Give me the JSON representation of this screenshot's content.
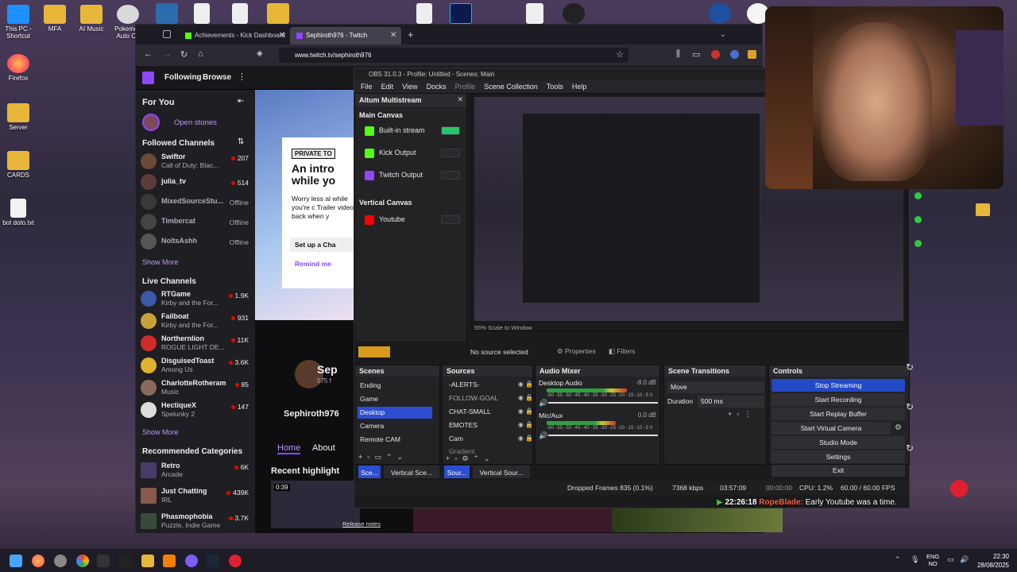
{
  "desktop": {
    "icons": [
      "This PC - Shortcut",
      "Firefox",
      "Server",
      "CARDS",
      "bot doto.txt"
    ],
    "top_icons": [
      "MFA",
      "AI Music",
      "Pokemon Auto Ch"
    ]
  },
  "browser": {
    "tabs": [
      {
        "label": "Achievements - Kick Dashboard"
      },
      {
        "label": "Sephiroth976 - Twitch"
      }
    ],
    "url": "www.twitch.tv/sephiroth976"
  },
  "twitch": {
    "nav": {
      "following": "Following",
      "browse": "Browse"
    },
    "for_you": "For You",
    "open_stories": "Open stories",
    "followed_header": "Followed Channels",
    "followed": [
      {
        "name": "Swiftor",
        "sub": "Call of Duty: Blac...",
        "viewers": "207"
      },
      {
        "name": "julia_tv",
        "sub": "",
        "viewers": "514"
      },
      {
        "name": "MixedSourceStu...",
        "sub": "",
        "viewers": "Offline"
      },
      {
        "name": "Timbercat",
        "sub": "",
        "viewers": "Offline"
      },
      {
        "name": "NoltsAshh",
        "sub": "",
        "viewers": "Offline"
      }
    ],
    "show_more": "Show More",
    "live_header": "Live Channels",
    "live": [
      {
        "name": "RTGame",
        "sub": "Kirby and the For...",
        "viewers": "1.9K"
      },
      {
        "name": "Failboat",
        "sub": "Kirby and the For...",
        "viewers": "931"
      },
      {
        "name": "Northernlion",
        "sub": "ROGUE LIGHT DE...",
        "viewers": "11K"
      },
      {
        "name": "DisguisedToast",
        "sub": "Among Us",
        "viewers": "3.6K"
      },
      {
        "name": "CharlotteRotheram",
        "sub": "Music",
        "viewers": "85"
      },
      {
        "name": "HectiqueX",
        "sub": "Spelunky 2",
        "viewers": "147"
      }
    ],
    "rec_header": "Recommended Categories",
    "categories": [
      {
        "name": "Retro",
        "sub": "Arcade",
        "viewers": "6K"
      },
      {
        "name": "Just Chatting",
        "sub": "IRL",
        "viewers": "439K"
      },
      {
        "name": "Phasmophobia",
        "sub": "Puzzle, Indie Game",
        "viewers": "3.7K"
      }
    ],
    "promo": {
      "badge": "PRIVATE TO",
      "headline": "An intro while yo",
      "body": "Worry less al while you're c Trailer video back when y",
      "cta1": "Set up a Cha",
      "cta2": "Remind me"
    },
    "channel": {
      "name": "Sephiroth976",
      "short": "Sep",
      "followers": "575 f",
      "tab_home": "Home",
      "tab_about": "About",
      "recent": "Recent highlight",
      "duration": "0:39",
      "release_notes": "Release notes"
    }
  },
  "obs": {
    "title": "OBS 31.0.3 - Profile: Untitled - Scenes: Main",
    "menu": [
      "File",
      "Edit",
      "View",
      "Docks",
      "Profile",
      "Scene Collection",
      "Tools",
      "Help"
    ],
    "multistream": {
      "title": "Aitum Multistream",
      "main_canvas": "Main Canvas",
      "outputs": [
        {
          "label": "Built-in stream",
          "on": true,
          "color": "#29c46a"
        },
        {
          "label": "Kick Output",
          "on": false,
          "color": "#53fc18"
        },
        {
          "label": "Twitch Output",
          "on": false,
          "color": "#9146ff"
        }
      ],
      "vertical_canvas": "Vertical Canvas",
      "vertical_outputs": [
        {
          "label": "Youtube",
          "on": false,
          "color": "#ff0000"
        }
      ]
    },
    "no_source": "No source selected",
    "properties": "Properties",
    "filters": "Filters",
    "preview_scale": "55%",
    "scale_mode": "Scale to Window",
    "docks": {
      "scenes": "Scenes",
      "sources": "Sources",
      "audio": "Audio Mixer",
      "transitions": "Scene Transitions",
      "controls": "Controls"
    },
    "scenes": [
      {
        "label": "Ending",
        "selected": false
      },
      {
        "label": "Game",
        "selected": false
      },
      {
        "label": "Desktop",
        "selected": true
      },
      {
        "label": "Camera",
        "selected": false
      },
      {
        "label": "Remote CAM",
        "selected": false
      }
    ],
    "sources": [
      "-ALERTS-",
      "FOLLOW-GOAL",
      "CHAT-SMALL",
      "EMOTES",
      "Cam",
      "Gradient"
    ],
    "audio": [
      {
        "name": "Desktop Audio",
        "db": "-8.0 dB",
        "level": 0.72
      },
      {
        "name": "Mic/Aux",
        "db": "0.0 dB",
        "level": 0.62
      }
    ],
    "meter_ticks": "-60 -55 -50 -45 -40 -35 -30 -25 -20 -15 -10 -5 0",
    "transition": {
      "type": "Move",
      "duration_label": "Duration",
      "duration": "500 ms"
    },
    "controls": [
      "Stop Streaming",
      "Start Recording",
      "Start Replay Buffer",
      "Start Virtual Camera",
      "Studio Mode",
      "Settings",
      "Exit"
    ],
    "bottom_tabs": {
      "scenes": "Sce...",
      "vscenes": "Vertical Sce...",
      "sources": "Sour...",
      "vsources": "Vertical Sour..."
    },
    "status": {
      "dropped": "Dropped Frames 835 (0.1%)",
      "bitrate": "7368 kbps",
      "stream_time": "03:57:09",
      "rec_time": "00:00:00",
      "cpu": "CPU: 1.2%",
      "fps": "60.00 / 60.00 FPS"
    }
  },
  "chat": {
    "time": "22:26:18",
    "user": "RopeBlade:",
    "message": "Early Youtube was a time."
  },
  "taskbar": {
    "lang": "ENG",
    "region": "NO",
    "time": "22:30",
    "date": "28/08/2025"
  },
  "colors": {
    "twitch_purple": "#9146ff",
    "obs_selected": "#2c4ecf",
    "live_red": "#eb0400"
  }
}
